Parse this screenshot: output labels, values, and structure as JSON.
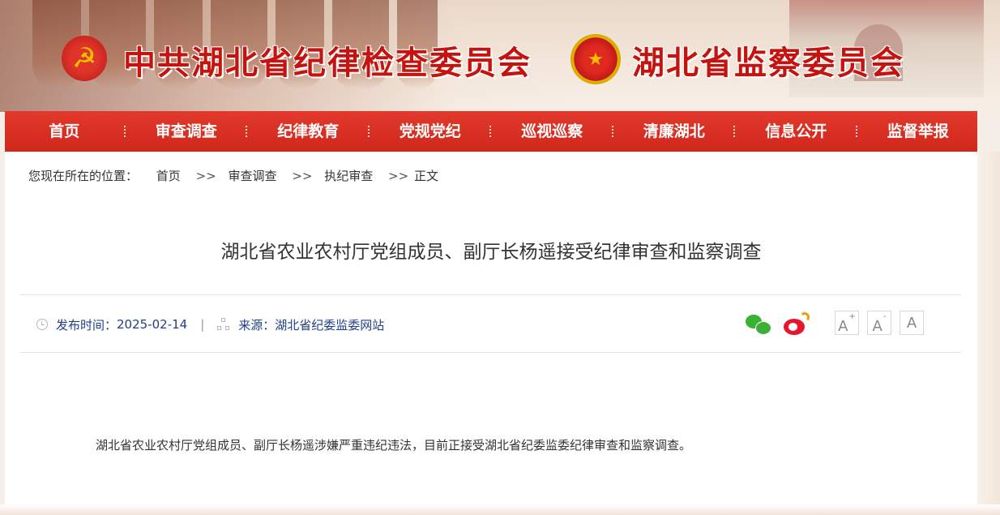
{
  "header": {
    "title_party": "中共湖北省纪律检查委员会",
    "title_state": "湖北省监察委员会",
    "party_emblem_icon": "hammer-sickle-icon",
    "state_emblem_icon": "national-emblem-icon",
    "brand_red": "#c5140f"
  },
  "nav": {
    "items": [
      "首页",
      "审查调查",
      "纪律教育",
      "党规党纪",
      "巡视巡察",
      "清廉湖北",
      "信息公开",
      "监督举报"
    ],
    "bg_color": "#d9301f"
  },
  "breadcrumb": {
    "prefix": "您现在所在的位置：",
    "items": [
      "首页",
      "审查调查",
      "执纪审查",
      "正文"
    ],
    "separator": ">>"
  },
  "article": {
    "title": "湖北省农业农村厅党组成员、副厅长杨遥接受纪律审查和监察调查",
    "publish_label": "发布时间：",
    "publish_date": "2025-02-14",
    "meta_divider": "|",
    "source_label": "来源：",
    "source": "湖北省纪委监委网站",
    "body": "湖北省农业农村厅党组成员、副厅长杨遥涉嫌严重违纪违法，目前正接受湖北省纪委监委纪律审查和监察调查。"
  },
  "share": {
    "wechat_icon": "wechat-icon",
    "weibo_icon": "weibo-icon"
  },
  "font_size_controls": {
    "increase_label": "A",
    "increase_mark": "+",
    "decrease_label": "A",
    "decrease_mark": "-",
    "reset_label": "A"
  }
}
